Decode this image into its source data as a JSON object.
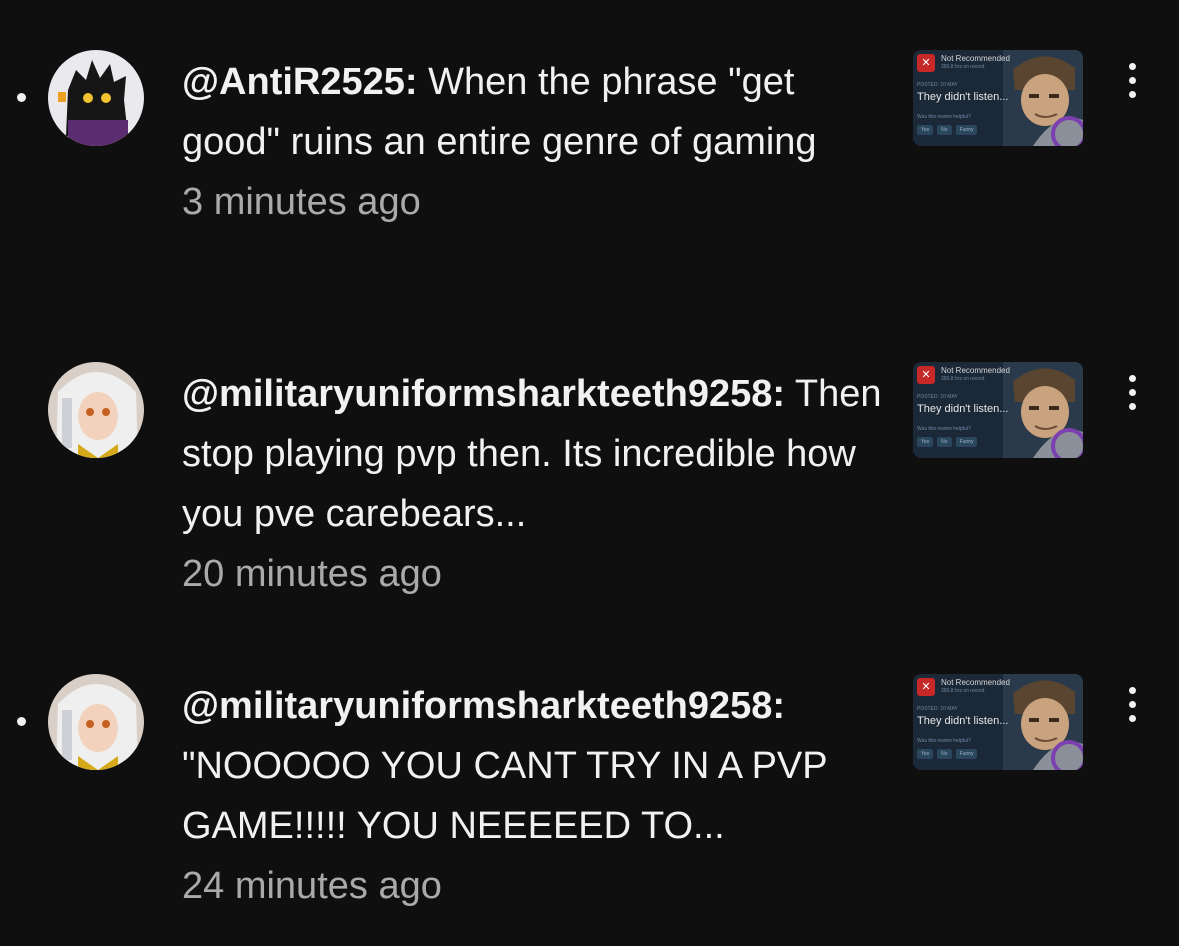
{
  "notifications": [
    {
      "unread": true,
      "author": "@AntiR2525:",
      "text": "When the phrase \"get good\" ruins an entire genre of gaming",
      "time": "3 minutes ago",
      "thumbnail": {
        "badge": "Not Recommended",
        "hours": "360.8 hrs on record",
        "posted": "POSTED: 10 MAY",
        "quote": "They didn't listen...",
        "helpful": "Was this review helpful?",
        "yes": "Yes",
        "no": "No",
        "funny": "Funny"
      }
    },
    {
      "unread": false,
      "author": "@militaryuniformsharkteeth9258:",
      "text": "Then stop playing pvp then. Its incredible how you pve carebears...",
      "time": "20 minutes ago",
      "thumbnail": {
        "badge": "Not Recommended",
        "hours": "360.8 hrs on record",
        "posted": "POSTED: 10 MAY",
        "quote": "They didn't listen...",
        "helpful": "Was this review helpful?",
        "yes": "Yes",
        "no": "No",
        "funny": "Funny"
      }
    },
    {
      "unread": true,
      "author": "@militaryuniformsharkteeth9258:",
      "text": "\"NOOOOO YOU CANT TRY IN A PVP GAME!!!!! YOU NEEEEED TO...",
      "time": "24 minutes ago",
      "thumbnail": {
        "badge": "Not Recommended",
        "hours": "360.8 hrs on record",
        "posted": "POSTED: 10 MAY",
        "quote": "They didn't listen...",
        "helpful": "Was this review helpful?",
        "yes": "Yes",
        "no": "No",
        "funny": "Funny"
      }
    }
  ],
  "colors": {
    "background": "#0f0f0f",
    "text": "#f1f1f1",
    "secondary_text": "#aaaaaa"
  },
  "icons": {
    "menu": "more-vert-icon",
    "unread": "unread-dot",
    "thumb_down": "thumbs-down-icon"
  }
}
